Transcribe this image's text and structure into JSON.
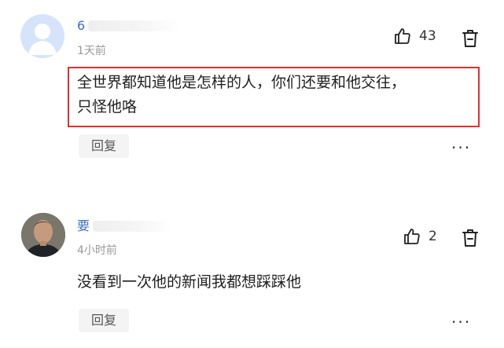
{
  "comments": [
    {
      "username": "6",
      "time": "1天前",
      "likes": "43",
      "text_line1": "全世界都知道他是怎样的人，你们还要和他交往，",
      "text_line2": "只怪他咯",
      "reply": "回复",
      "more": "···",
      "highlighted": true,
      "highlight_color": "#e02f2f"
    },
    {
      "username": "要",
      "time": "4小时前",
      "likes": "2",
      "text": "没看到一次他的新闻我都想踩踩他",
      "reply": "回复",
      "more": "···"
    }
  ],
  "colors": {
    "username": "#3e6fb7",
    "meta": "#999999"
  },
  "icons": {
    "like": "thumbs-up-icon",
    "delete": "trash-icon",
    "more": "more-dots-icon"
  }
}
